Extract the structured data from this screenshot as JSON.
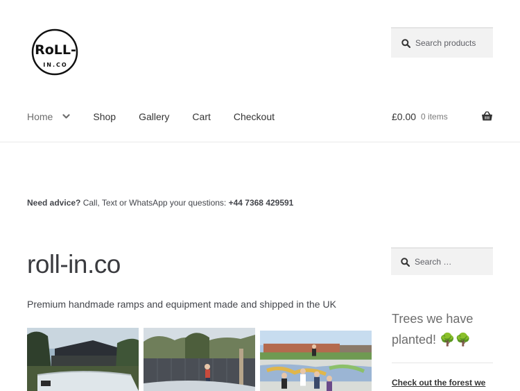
{
  "header": {
    "logo_text": "RoLL-IN.CO",
    "search": {
      "placeholder": "Search products"
    }
  },
  "nav": {
    "items": [
      {
        "label": "Home",
        "has_dropdown": true
      },
      {
        "label": "Shop"
      },
      {
        "label": "Gallery"
      },
      {
        "label": "Cart"
      },
      {
        "label": "Checkout"
      }
    ]
  },
  "cart": {
    "amount": "£0.00",
    "items": "0 items",
    "icon": "basket-icon"
  },
  "advice": {
    "lead": "Need advice?",
    "text": " Call, Text or WhatsApp your questions: ",
    "phone": "+44 7368 429591"
  },
  "main": {
    "title": "roll-in.co",
    "tagline": "Premium handmade ramps and equipment made and shipped in the UK"
  },
  "sidebar": {
    "search": {
      "placeholder": "Search …"
    },
    "widget_title": "Trees we have planted! 🌳🌳",
    "link": "Check out the forest we"
  },
  "colors": {
    "text": "#43454b",
    "link": "#333333",
    "search_bg": "#f2f2f2"
  }
}
